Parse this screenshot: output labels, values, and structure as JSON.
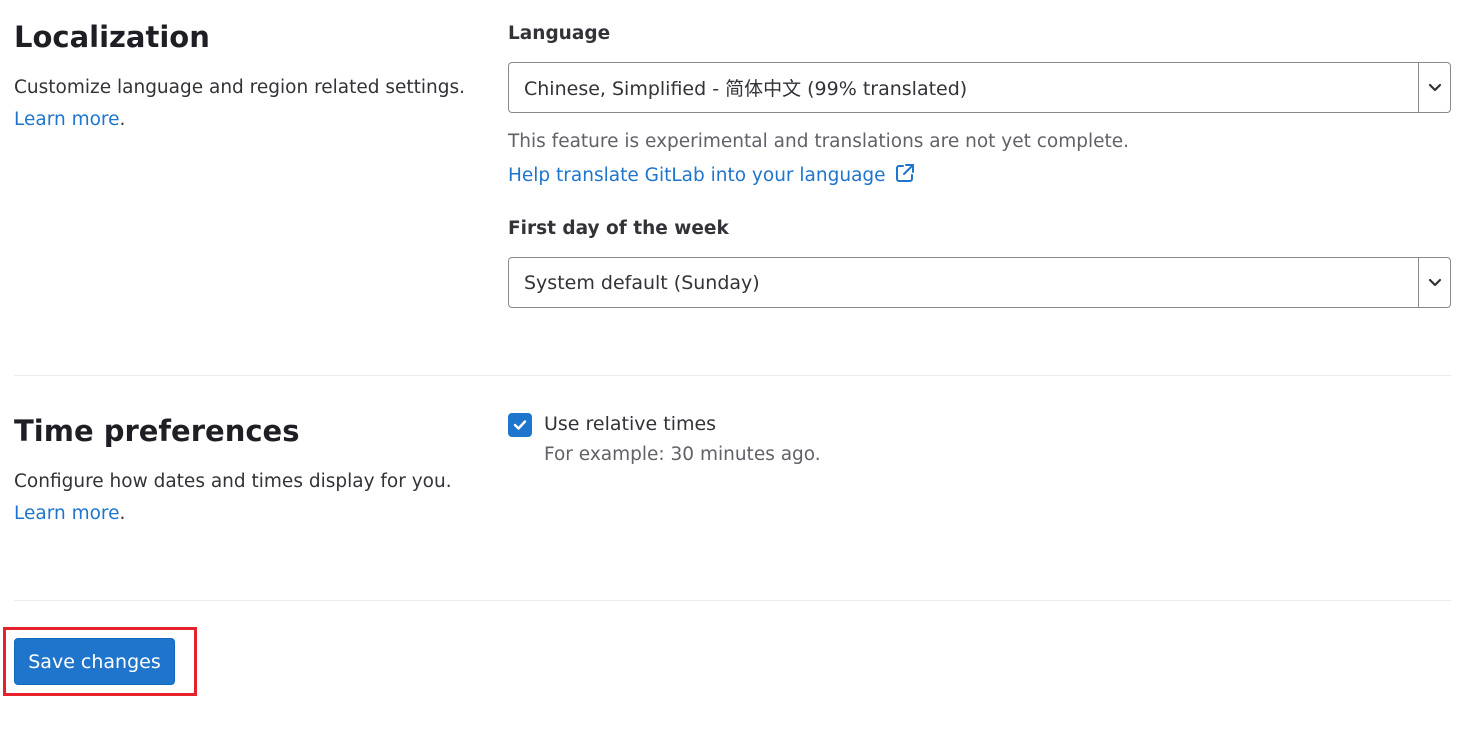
{
  "localization": {
    "title": "Localization",
    "description": "Customize language and region related settings.",
    "learn_more": "Learn more",
    "learn_more_suffix": ".",
    "language": {
      "label": "Language",
      "value": "Chinese, Simplified - 简体中文 (99% translated)",
      "help_text": "This feature is experimental and translations are not yet complete.",
      "help_link": "Help translate GitLab into your language",
      "help_link_icon": "external-link-icon"
    },
    "first_day": {
      "label": "First day of the week",
      "value": "System default (Sunday)"
    }
  },
  "time_preferences": {
    "title": "Time preferences",
    "description": "Configure how dates and times display for you.",
    "learn_more": "Learn more",
    "learn_more_suffix": ".",
    "relative_times": {
      "label": "Use relative times",
      "checked": true,
      "help_text": "For example: 30 minutes ago."
    }
  },
  "actions": {
    "save_label": "Save changes"
  },
  "colors": {
    "accent": "#1f75cb",
    "highlight": "#e5222b"
  }
}
